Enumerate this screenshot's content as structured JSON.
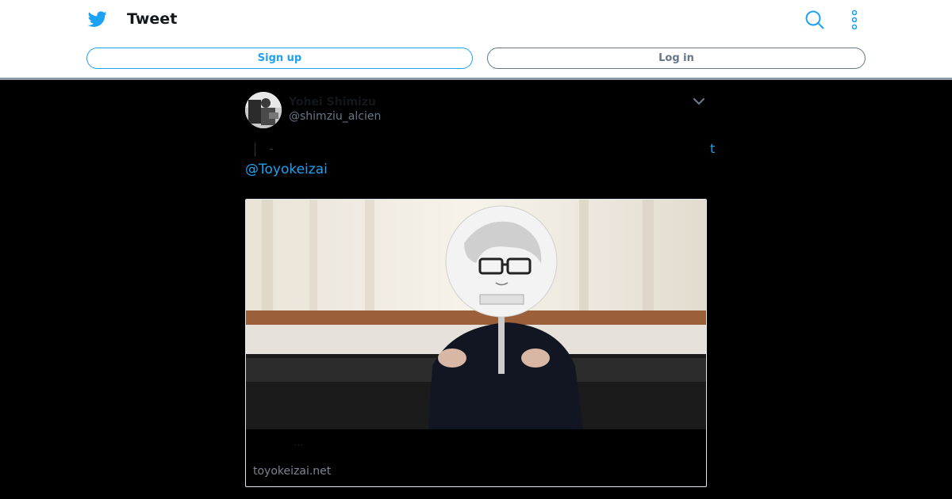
{
  "header": {
    "title": "Tweet",
    "logo_icon": "twitter-bird-icon",
    "search_icon": "search-icon",
    "more_icon": "more-vertical-icon",
    "brand_color": "#1da1f2"
  },
  "auth": {
    "signup_label": "Sign up",
    "login_label": "Log in"
  },
  "tweet": {
    "display_name": "Yohei Shimizu",
    "handle": "@shimziu_alcien",
    "text_dash": "-",
    "text_link_fragment": "t",
    "mention": "@Toyokeizai"
  },
  "card": {
    "title": "...",
    "domain": "toyokeizai.net"
  }
}
